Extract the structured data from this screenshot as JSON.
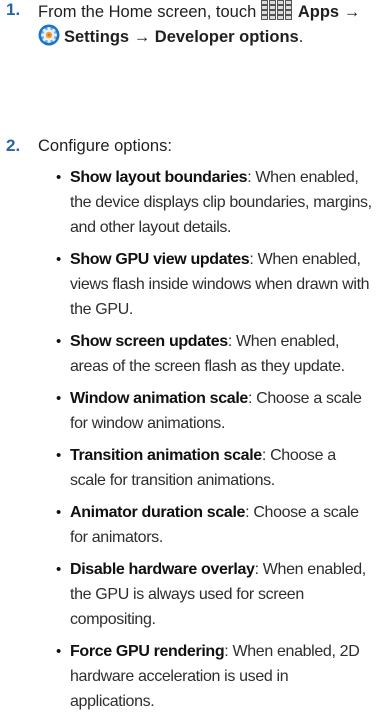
{
  "steps": [
    {
      "number": "1.",
      "line1_prefix": "From the Home screen, touch",
      "apps_icon": "apps-grid-icon",
      "apps_label": "Apps",
      "arrow1": "→",
      "settings_icon": "settings-gear-icon",
      "settings_label": "Settings",
      "arrow2": "→",
      "developer_label": "Developer options",
      "end_punct": "."
    },
    {
      "number": "2.",
      "text": "Configure options:"
    }
  ],
  "options": [
    {
      "term": "Show layout boundaries",
      "desc": "When enabled, the device displays clip boundaries, margins, and other layout details."
    },
    {
      "term": "Show GPU view updates",
      "desc": "When enabled, views flash inside windows  when drawn with the GPU."
    },
    {
      "term": "Show screen updates",
      "desc": "When enabled, areas of the screen flash as they update."
    },
    {
      "term": "Window animation scale",
      "desc": "Choose a scale for window animations."
    },
    {
      "term": "Transition animation scale",
      "desc": "Choose a scale for transition animations."
    },
    {
      "term": "Animator duration scale",
      "desc": "Choose a scale for animators."
    },
    {
      "term": "Disable hardware overlay",
      "desc": "When enabled, the GPU is always used for screen compositing."
    },
    {
      "term": "Force GPU rendering",
      "desc": "When enabled, 2D hardware acceleration is used in applications."
    }
  ],
  "colors": {
    "step_number": "#2a63a8",
    "settings_icon_outer": "#1e73c8",
    "settings_icon_inner": "#f2a23a"
  }
}
